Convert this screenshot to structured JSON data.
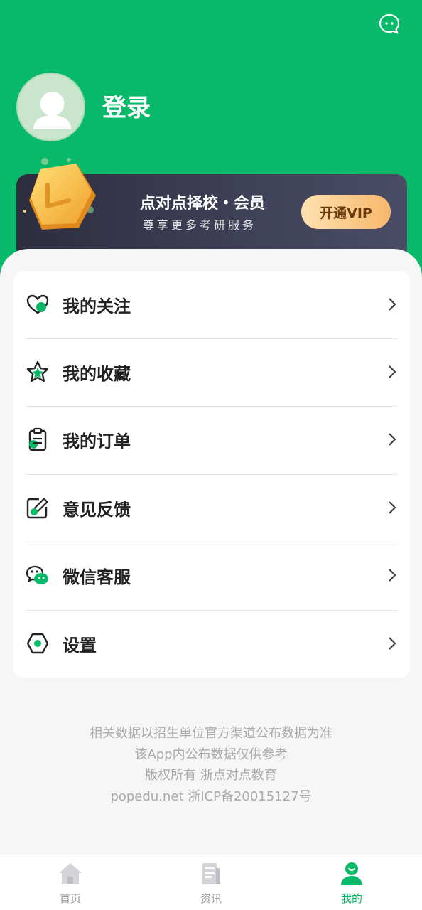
{
  "header": {
    "login_label": "登录"
  },
  "vip": {
    "title": "点对点择校・会员",
    "subtitle": "尊享更多考研服务",
    "button_label": "开通VIP"
  },
  "menu": {
    "items": [
      {
        "label": "我的关注",
        "icon": "heart-icon"
      },
      {
        "label": "我的收藏",
        "icon": "star-icon"
      },
      {
        "label": "我的订单",
        "icon": "clipboard-icon"
      },
      {
        "label": "意见反馈",
        "icon": "edit-icon"
      },
      {
        "label": "微信客服",
        "icon": "wechat-icon"
      },
      {
        "label": "设置",
        "icon": "settings-icon"
      }
    ]
  },
  "footer": {
    "lines": [
      "相关数据以招生单位官方渠道公布数据为准",
      "该App内公布数据仅供参考",
      "版权所有 浙点对点教育",
      "popedu.net 浙ICP备20015127号"
    ]
  },
  "tabbar": {
    "tabs": [
      {
        "label": "首页",
        "icon": "home-icon",
        "active": false
      },
      {
        "label": "资讯",
        "icon": "news-icon",
        "active": false
      },
      {
        "label": "我的",
        "icon": "profile-icon",
        "active": true
      }
    ]
  },
  "colors": {
    "brand_green": "#07b968",
    "vip_card": "#3f4158",
    "vip_button": "#f6b86b"
  }
}
